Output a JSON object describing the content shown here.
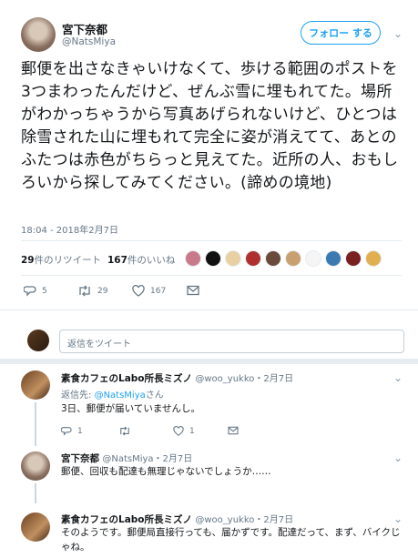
{
  "main_tweet": {
    "display_name": "宮下奈都",
    "handle": "@NatsMiya",
    "follow_label": "フォロー する",
    "text": "郵便を出さなきゃいけなくて、歩ける範囲のポストを3つまわったんだけど、ぜんぶ雪に埋もれてた。場所がわかっちゃうから写真あげられないけど、ひとつは除雪された山に埋もれて完全に姿が消えてて、あとのふたつは赤色がちらっと見えてた。近所の人、おもしろいから探してみてください。(諦めの境地)",
    "timestamp": "18:04 - 2018年2月7日",
    "retweet_count": "29",
    "retweet_suffix": "件のリツイート",
    "like_count": "167",
    "like_suffix": "件のいいね",
    "actions": {
      "reply": "5",
      "retweet": "29",
      "like": "167"
    },
    "liker_icons": [
      "#c97a8a",
      "#111111",
      "#e8d0a0",
      "#b03030",
      "#6a4a3a",
      "#c8a070",
      "#f5f5f5",
      "#3a7ab0",
      "#7a2020",
      "#e0b050"
    ]
  },
  "reply_box": {
    "placeholder": "返信をツイート"
  },
  "replies": [
    {
      "display_name": "素食カフェのLabo所長ミズノ",
      "handle": "@woo_yukko",
      "date": "・2月7日",
      "reply_to_label": "返信先:",
      "reply_to_handle": "@NatsMiya",
      "reply_to_suffix": "さん",
      "text": "3日、郵便が届いていませんし。",
      "reply_count": "1",
      "retweet_count": "",
      "like_count": "1"
    },
    {
      "display_name": "宮下奈都",
      "handle": "@NatsMiya",
      "date": "・2月7日",
      "text": "郵便、回収も配達も無理じゃないでしょうか……"
    },
    {
      "display_name": "素食カフェのLabo所長ミズノ",
      "handle": "@woo_yukko",
      "date": "・2月7日",
      "text": "そのようです。郵便局直接行っても、届かずです。配達だって、まず、バイクじゃね。"
    }
  ],
  "colors": {
    "accent": "#1da1f2",
    "muted": "#657786",
    "border": "#e6ecf0"
  }
}
